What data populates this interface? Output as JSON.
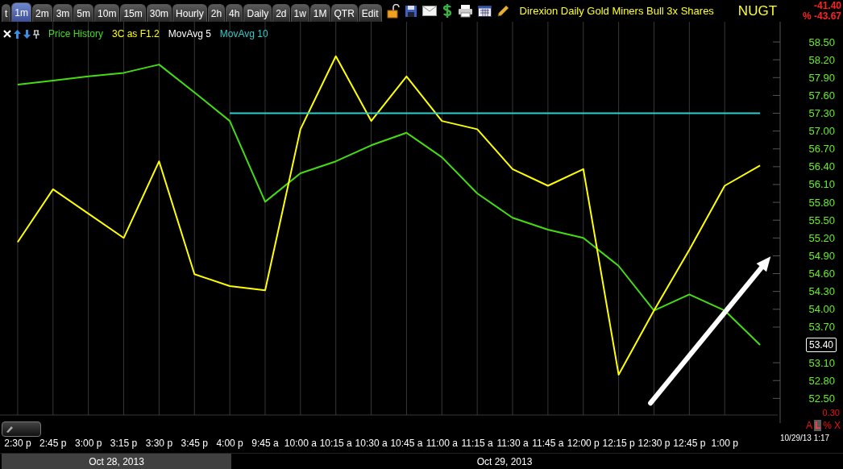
{
  "tabs": [
    {
      "label": "t",
      "selected": false
    },
    {
      "label": "1m",
      "selected": true
    },
    {
      "label": "2m",
      "selected": false
    },
    {
      "label": "3m",
      "selected": false
    },
    {
      "label": "5m",
      "selected": false
    },
    {
      "label": "10m",
      "selected": false
    },
    {
      "label": "15m",
      "selected": false
    },
    {
      "label": "30m",
      "selected": false
    },
    {
      "label": "Hourly",
      "selected": false
    },
    {
      "label": "2h",
      "selected": false
    },
    {
      "label": "4h",
      "selected": false
    },
    {
      "label": "Daily",
      "selected": false
    },
    {
      "label": "2d",
      "selected": false
    },
    {
      "label": "1w",
      "selected": false
    },
    {
      "label": "1M",
      "selected": false
    },
    {
      "label": "QTR",
      "selected": false
    },
    {
      "label": "Edit",
      "selected": false
    }
  ],
  "toolbar": [
    {
      "kind": "lock"
    },
    {
      "kind": "save"
    },
    {
      "kind": "mail"
    },
    {
      "kind": "dollar"
    },
    {
      "kind": "print"
    },
    {
      "kind": "grid"
    },
    {
      "kind": "pencil"
    }
  ],
  "instrument": {
    "name": "Direxion Daily Gold Miners Bull 3x Shares",
    "symbol": "NUGT",
    "change": "-41.40",
    "percent_change": "% -43.67"
  },
  "chart_data": {
    "type": "line",
    "grid": true,
    "categories": [
      "2:30 p",
      "2:45 p",
      "3:00 p",
      "3:15 p",
      "3:30 p",
      "3:45 p",
      "4:00 p",
      "9:45 a",
      "10:00 a",
      "10:15 a",
      "10:30 a",
      "10:45 a",
      "11:00 a",
      "11:15 a",
      "11:30 a",
      "11:45 a",
      "12:00 p",
      "12:15 p",
      "12:30 p",
      "12:45 p",
      "1:00 p",
      null
    ],
    "ylim": [
      52.22,
      58.84
    ],
    "yticks": [
      {
        "value": 58.5,
        "label": "58.50"
      },
      {
        "value": 58.2,
        "label": "58.20"
      },
      {
        "value": 57.9,
        "label": "57.90"
      },
      {
        "value": 57.6,
        "label": "57.60"
      },
      {
        "value": 57.3,
        "label": "57.30"
      },
      {
        "value": 57.0,
        "label": "57.00"
      },
      {
        "value": 56.7,
        "label": "56.70"
      },
      {
        "value": 56.4,
        "label": "56.40"
      },
      {
        "value": 56.1,
        "label": "56.10"
      },
      {
        "value": 55.8,
        "label": "55.80"
      },
      {
        "value": 55.5,
        "label": "55.50"
      },
      {
        "value": 55.2,
        "label": "55.20"
      },
      {
        "value": 54.9,
        "label": "54.90"
      },
      {
        "value": 54.6,
        "label": "54.60"
      },
      {
        "value": 54.3,
        "label": "54.30"
      },
      {
        "value": 54.0,
        "label": "54.00"
      },
      {
        "value": 53.7,
        "label": "53.70"
      },
      {
        "value": 53.1,
        "label": "53.10"
      },
      {
        "value": 52.8,
        "label": "52.80"
      },
      {
        "value": 52.5,
        "label": "52.50"
      }
    ],
    "series": [
      {
        "name": "Price History",
        "color": "#44dd11",
        "values": [
          57.78,
          57.85,
          57.92,
          57.98,
          58.12,
          57.65,
          57.17,
          55.81,
          56.29,
          56.49,
          56.76,
          56.97,
          56.56,
          55.95,
          55.54,
          55.34,
          55.2,
          54.73,
          53.98,
          54.25,
          53.98,
          53.4
        ]
      },
      {
        "name": "3C as F1.2",
        "color": "#ffff00",
        "values": [
          55.13,
          56.02,
          55.61,
          55.2,
          56.49,
          54.59,
          54.39,
          54.32,
          57.03,
          58.26,
          57.17,
          57.92,
          57.17,
          57.03,
          56.36,
          56.08,
          56.36,
          52.9,
          53.98,
          55.0,
          56.08,
          56.42
        ]
      },
      {
        "name": "MovAvg 5",
        "color": "#ffffff",
        "values": [
          null,
          null,
          null,
          null,
          null,
          null,
          null,
          null,
          null,
          null,
          null,
          null,
          null,
          null,
          null,
          null,
          null,
          null,
          null,
          null,
          null,
          null
        ]
      },
      {
        "name": "MovAvg 10",
        "color": "#33cccc",
        "values": [
          null,
          null,
          null,
          null,
          null,
          null,
          57.3,
          57.3,
          57.3,
          57.3,
          57.3,
          57.3,
          57.3,
          57.3,
          57.3,
          57.3,
          57.3,
          57.3,
          57.3,
          57.3,
          57.3,
          57.3
        ]
      }
    ]
  },
  "last_price": "53.40",
  "scale": "0.30",
  "scale_buttons": [
    {
      "label": "A",
      "selected": false
    },
    {
      "label": "L",
      "selected": true
    },
    {
      "label": "%",
      "selected": false
    },
    {
      "label": "X",
      "selected": false
    }
  ],
  "current_time": "10/29/13 1:17",
  "dates": [
    {
      "label": "Oct 28, 2013",
      "highlighted": true
    },
    {
      "label": "Oct 29, 2013",
      "highlighted": false
    }
  ]
}
